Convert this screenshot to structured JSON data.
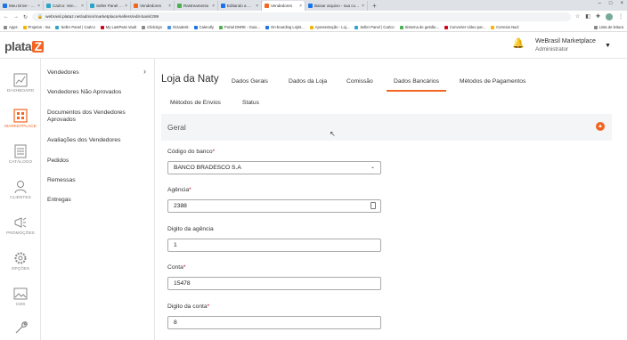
{
  "browser": {
    "tabs": [
      {
        "title": "Meu Drive - Google Drive",
        "color": "#1a73e8",
        "active": false
      },
      {
        "title": "CaZco: Vendas (Vendas e...",
        "color": "#2aa4c8",
        "active": false
      },
      {
        "title": "Seller Panel | CaZco",
        "color": "#2aa4c8",
        "active": false
      },
      {
        "title": "Vendedores",
        "color": "#f26522",
        "active": false
      },
      {
        "title": "Rastreamento",
        "color": "#4caf50",
        "active": false
      },
      {
        "title": "Editando a Página Finaliz...",
        "color": "#1a73e8",
        "active": false
      },
      {
        "title": "Vendedores",
        "color": "#f26522",
        "active": true
      },
      {
        "title": "Baixar arquivo - sua cont...",
        "color": "#1a73e8",
        "active": false
      }
    ],
    "url": "webrasil.plataz.net/admin/marketplace/sellers/edit-bank/299",
    "bookmarks": [
      "Apps",
      "Projetos - Ina",
      "Seller Panel | CaZco",
      "My LastPass Vault",
      "Clickzign",
      "Octadesk",
      "Calendly",
      "Portal DNRE - Guia...",
      "On-boarding Lojist...",
      "Apresentação - Loj...",
      "Seller Panel | CaZco",
      "Sistema de gestão...",
      "Converter vídeo par...",
      "Correios Nacl"
    ],
    "bookmarks_right": "Lista de leitura"
  },
  "header": {
    "logo": "plata",
    "logo_z": "Z",
    "user_name": "WeBrasil Marketplace",
    "user_role": "Administrator"
  },
  "leftnav": [
    {
      "label": "DASHBOARD",
      "icon": "chart-icon",
      "active": false
    },
    {
      "label": "MARKETPLACE",
      "icon": "store-icon",
      "active": true
    },
    {
      "label": "CATÁLOGO",
      "icon": "catalog-icon",
      "active": false
    },
    {
      "label": "CLIENTES",
      "icon": "user-icon",
      "active": false
    },
    {
      "label": "PROMOÇÕES",
      "icon": "megaphone-icon",
      "active": false
    },
    {
      "label": "OPÇÕES",
      "icon": "gear-icon",
      "active": false
    },
    {
      "label": "CMS",
      "icon": "image-icon",
      "active": false
    },
    {
      "label": "",
      "icon": "wrench-icon",
      "active": false
    }
  ],
  "subnav": {
    "items": [
      "Vendedores",
      "Vendedores Não Aprovados",
      "Documentos dos Vendedores Aprovados",
      "Avaliações dos Vendedores",
      "Pedidos",
      "Remessas",
      "Entregas"
    ]
  },
  "content": {
    "store_title": "Loja da Naty",
    "tabs": [
      "Dados Gerais",
      "Dados da Loja",
      "Comissão",
      "Dados Bancários",
      "Métodos de Pagamentos",
      "Métodos de Envios",
      "Status"
    ],
    "active_tab": "Dados Bancários",
    "section_title": "Geral",
    "fields": {
      "bank_label": "Código do banco",
      "bank_value": "BANCO BRADESCO S.A",
      "agency_label": "Agência",
      "agency_value": "2388",
      "agency_digit_label": "Digito da agência",
      "agency_digit_value": "1",
      "account_label": "Conta",
      "account_value": "15478",
      "account_digit_label": "Digito da conta",
      "account_digit_value": "8",
      "required_mark": "*"
    }
  },
  "colors": {
    "accent": "#f26522"
  }
}
